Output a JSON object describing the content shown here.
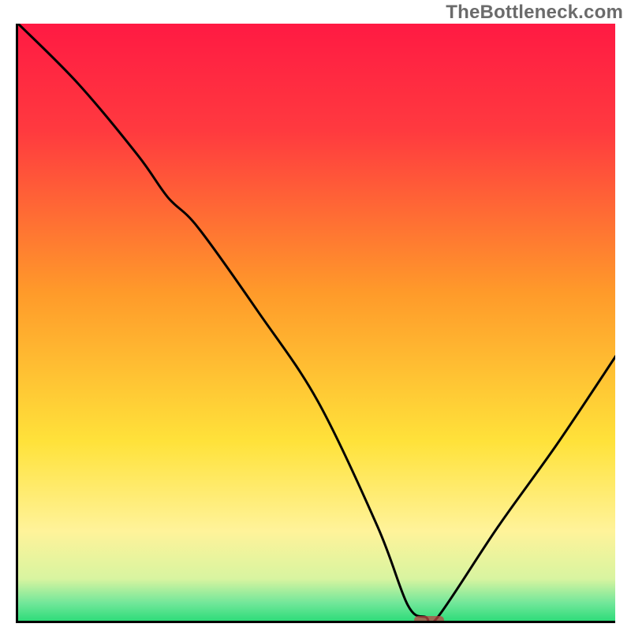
{
  "watermark": "TheBottleneck.com",
  "colors": {
    "axis": "#000000",
    "curve": "#000000",
    "marker": "#b94644",
    "watermark": "#6b6b6b",
    "gradient_top_red": "#ff1a43",
    "gradient_mid_orange": "#ff7a2a",
    "gradient_yellow": "#ffe23a",
    "gradient_light_yellow": "#fff8a0",
    "gradient_pale": "#e7f7b8",
    "gradient_green": "#2fdc7a"
  },
  "chart_data": {
    "type": "line",
    "title": "",
    "xlabel": "",
    "ylabel": "",
    "xlim": [
      0,
      100
    ],
    "ylim": [
      0,
      100
    ],
    "note": "No axis ticks or numeric labels are rendered in the image. Curve values are visually estimated from the plot (y=0 at bottom/green, y=100 at top/red). The curve appears to represent bottleneck percentage vs. some swept parameter, with a minimum plateau near x≈65–70.",
    "series": [
      {
        "name": "bottleneck-curve",
        "x": [
          0,
          10,
          20,
          25,
          30,
          40,
          50,
          60,
          65,
          68,
          70,
          80,
          90,
          100
        ],
        "y": [
          100,
          90,
          78,
          71,
          66,
          52,
          37,
          16,
          3,
          1,
          1,
          16,
          30,
          45
        ]
      }
    ],
    "marker": {
      "name": "optimal-region",
      "x_start": 66,
      "x_end": 71,
      "y": 0.5
    },
    "background_gradient_stops": [
      {
        "pct": 0,
        "color": "#ff1a43"
      },
      {
        "pct": 18,
        "color": "#ff3a3f"
      },
      {
        "pct": 45,
        "color": "#ff9a2a"
      },
      {
        "pct": 70,
        "color": "#ffe23a"
      },
      {
        "pct": 85,
        "color": "#fff39a"
      },
      {
        "pct": 93,
        "color": "#d8f4a0"
      },
      {
        "pct": 97,
        "color": "#72e79a"
      },
      {
        "pct": 100,
        "color": "#2fdc7a"
      }
    ]
  }
}
